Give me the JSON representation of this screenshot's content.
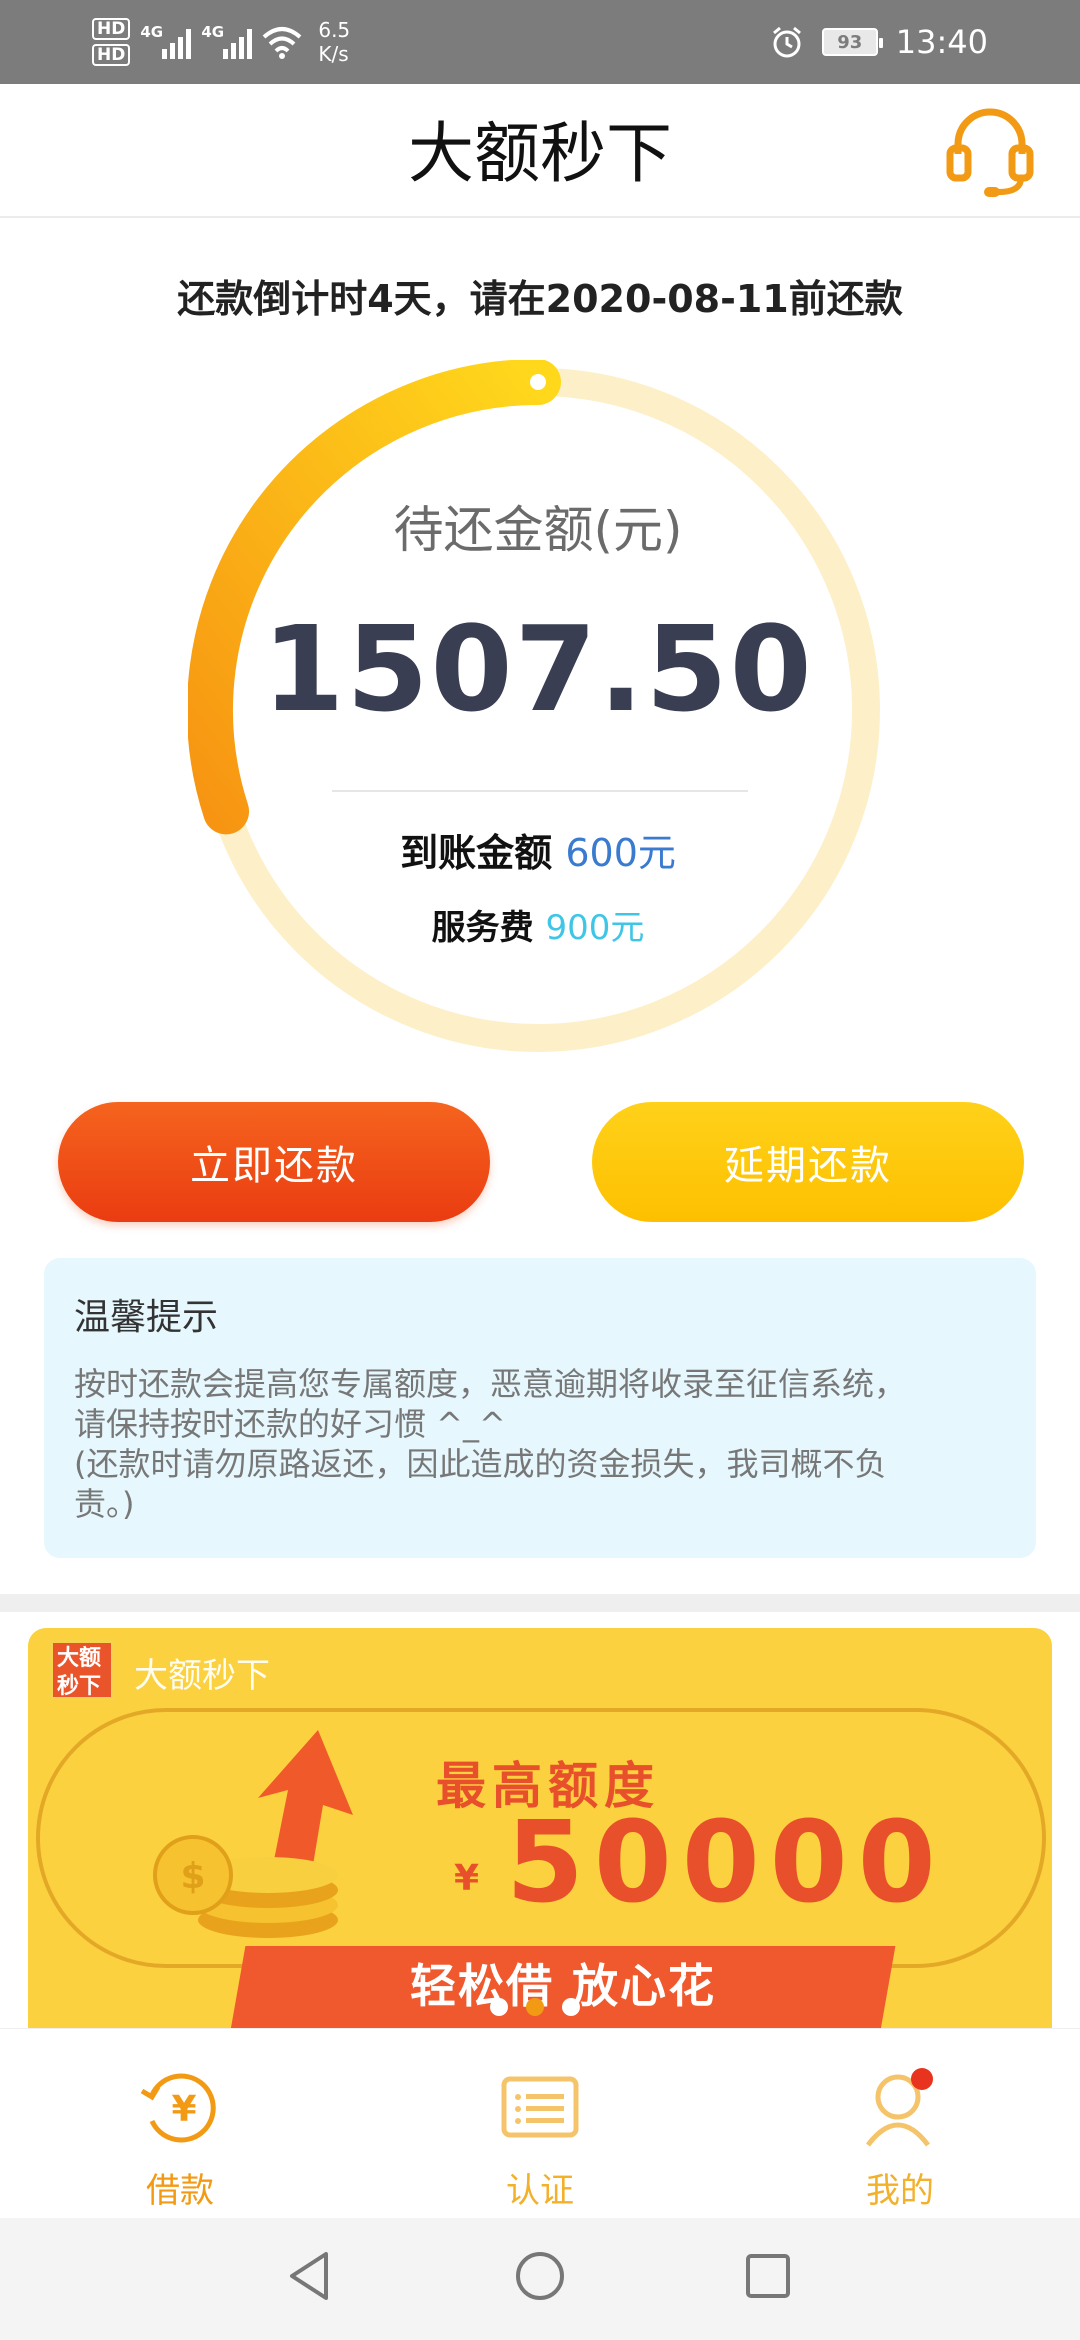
{
  "status_bar": {
    "hd1": "HD",
    "hd2": "HD",
    "net1": "4G",
    "net2": "4G",
    "speed_value": "6.5",
    "speed_unit": "K/s",
    "battery": "93",
    "time": "13:40"
  },
  "header": {
    "title": "大额秒下",
    "support_icon": "headset-icon"
  },
  "countdown": "还款倒计时4天，请在2020-08-11前还款",
  "ring": {
    "progress": 0.3,
    "label": "待还金额(元)",
    "amount": "1507.50",
    "received_label": "到账金额",
    "received_value": "600元",
    "fee_label": "服务费",
    "fee_value": "900元"
  },
  "buttons": {
    "repay": "立即还款",
    "delay": "延期还款"
  },
  "tips": {
    "title": "温馨提示",
    "body_line1": "按时还款会提高您专属额度，恶意逾期将收录至征信系统，",
    "body_line2": "请保持按时还款的好习惯 ^_^",
    "body_line3": "(还款时请勿原路返还，因此造成的资金损失，我司概不负",
    "body_line4": "责。)"
  },
  "banner": {
    "logo_text": "大额秒下",
    "brand": "大额秒下",
    "title": "最高额度",
    "currency": "¥",
    "amount": "50000",
    "slogan": "轻松借 放心花",
    "active_slide": 2,
    "slide_count": 3
  },
  "bottom_nav": {
    "items": [
      {
        "label": "借款",
        "icon": "loan-yen-icon"
      },
      {
        "label": "认证",
        "icon": "id-card-icon"
      },
      {
        "label": "我的",
        "icon": "user-icon"
      }
    ]
  },
  "colors": {
    "accent_orange": "#f39a14",
    "repay_red": "#ea3c11",
    "delay_yellow": "#fdc000",
    "ring_track": "#fdf0c8"
  }
}
